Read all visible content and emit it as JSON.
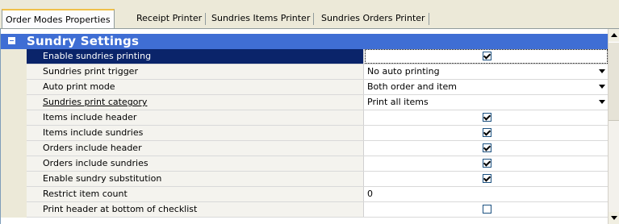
{
  "tabs": [
    {
      "label": "Order Modes Properties",
      "active": true
    },
    {
      "label": "Receipt Printer",
      "active": false
    },
    {
      "label": "Sundries Items Printer",
      "active": false
    },
    {
      "label": "Sundries Orders Printer",
      "active": false
    }
  ],
  "category": {
    "title": "Sundry Settings",
    "expanded": true
  },
  "properties": [
    {
      "name": "Enable sundries printing",
      "type": "checkbox",
      "checked": true,
      "selected": true
    },
    {
      "name": "Sundries print trigger",
      "type": "dropdown",
      "value": "No auto printing"
    },
    {
      "name": "Auto print mode",
      "type": "dropdown",
      "value": "Both order and item"
    },
    {
      "name": "Sundries print category",
      "type": "dropdown",
      "value": "Print all items",
      "underlined": true
    },
    {
      "name": "Items include header",
      "type": "checkbox",
      "checked": true
    },
    {
      "name": "Items include sundries",
      "type": "checkbox",
      "checked": true
    },
    {
      "name": "Orders include header",
      "type": "checkbox",
      "checked": true
    },
    {
      "name": "Orders include sundries",
      "type": "checkbox",
      "checked": true
    },
    {
      "name": "Enable sundry substitution",
      "type": "checkbox",
      "checked": true
    },
    {
      "name": "Restrict item count",
      "type": "text",
      "value": "0"
    },
    {
      "name": "Print header at bottom of checklist",
      "type": "checkbox",
      "checked": false
    }
  ],
  "colors": {
    "category_bg": "#3f6ed4",
    "selection_bg": "#0a246a",
    "window_bg": "#ece9d8"
  }
}
